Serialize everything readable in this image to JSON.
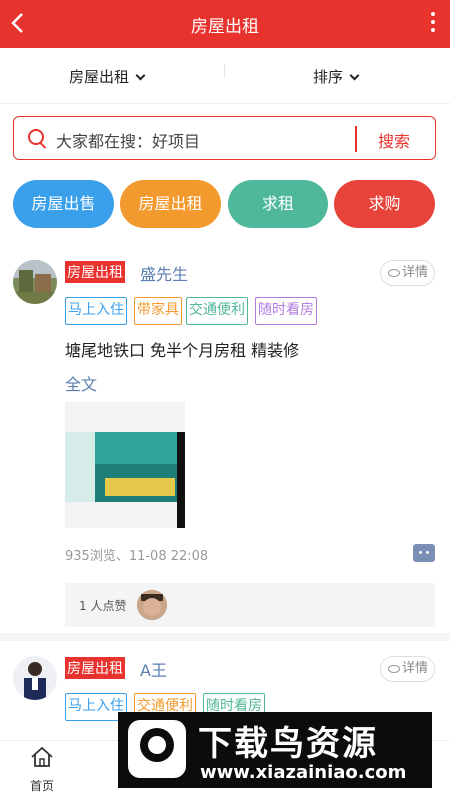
{
  "header": {
    "title": "房屋出租"
  },
  "filters": {
    "left": "房屋出租",
    "right": "排序"
  },
  "search": {
    "placeholder": "大家都在搜：好项目",
    "button": "搜索"
  },
  "categories": [
    {
      "label": "房屋出售",
      "color": "#3aa0ec"
    },
    {
      "label": "房屋出租",
      "color": "#f39a2e"
    },
    {
      "label": "求租",
      "color": "#4fb79a"
    },
    {
      "label": "求购",
      "color": "#e8433a"
    }
  ],
  "posts": [
    {
      "tag": "房屋出租",
      "name": "盛先生",
      "detail": "详情",
      "chips": [
        {
          "label": "马上入住",
          "color": "#3aa0ec"
        },
        {
          "label": "带家具",
          "color": "#f39a2e"
        },
        {
          "label": "交通便利",
          "color": "#4fb79a"
        },
        {
          "label": "随时看房",
          "color": "#b27be0"
        }
      ],
      "content": "塘尾地铁口 免半个月房租 精装修",
      "fulltext": "全文",
      "meta": "935浏览、11-08 22:08",
      "likes": "1 人点赞"
    },
    {
      "tag": "房屋出租",
      "name": "A王",
      "detail": "详情",
      "chips": [
        {
          "label": "马上入住",
          "color": "#3aa0ec"
        },
        {
          "label": "交通便利",
          "color": "#f39a2e"
        },
        {
          "label": "随时看房",
          "color": "#4fb79a"
        }
      ]
    }
  ],
  "tabbar": {
    "home": "首页"
  },
  "watermark": {
    "title": "下载鸟资源",
    "url": "www.xiazainiao.com"
  }
}
